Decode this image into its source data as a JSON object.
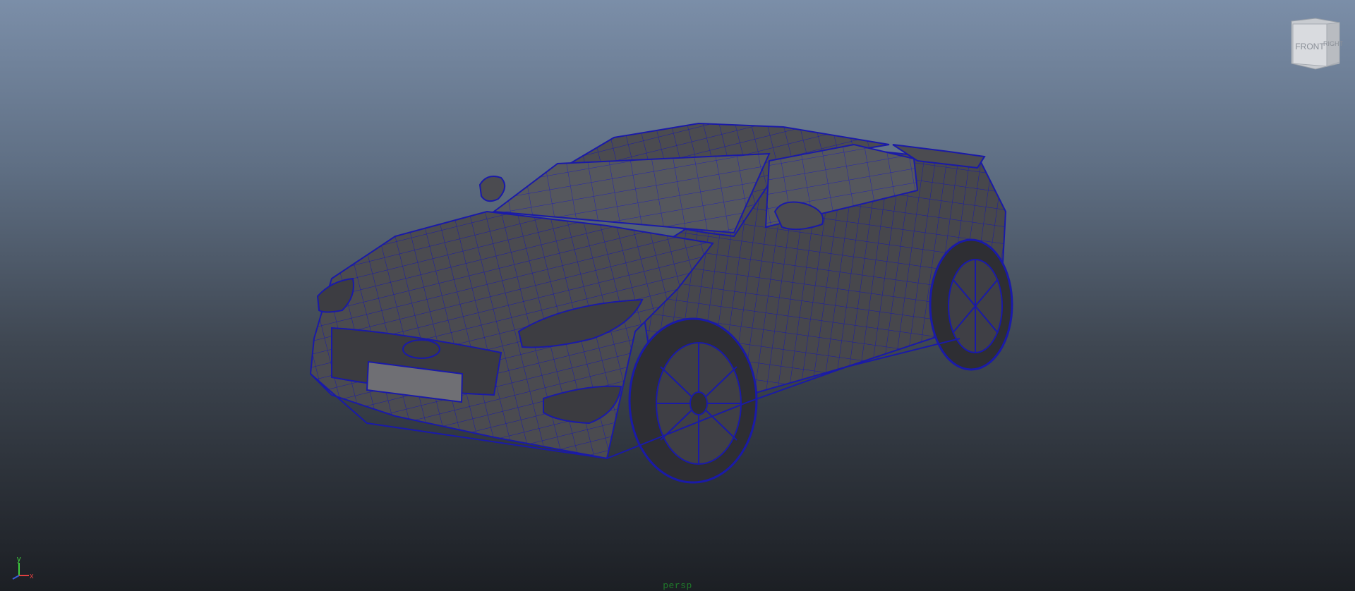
{
  "viewport": {
    "camera_label": "persp"
  },
  "view_cube": {
    "front_label": "FRONT",
    "right_label": "RIGHT"
  },
  "axis_indicator": {
    "y_label": "y",
    "x_label": "x",
    "y_color": "#3ecf3e",
    "x_color": "#e04040",
    "z_color": "#3a5bd9"
  },
  "colors": {
    "wireframe": "#1a1aa8",
    "surface": "#4a4a4e"
  }
}
